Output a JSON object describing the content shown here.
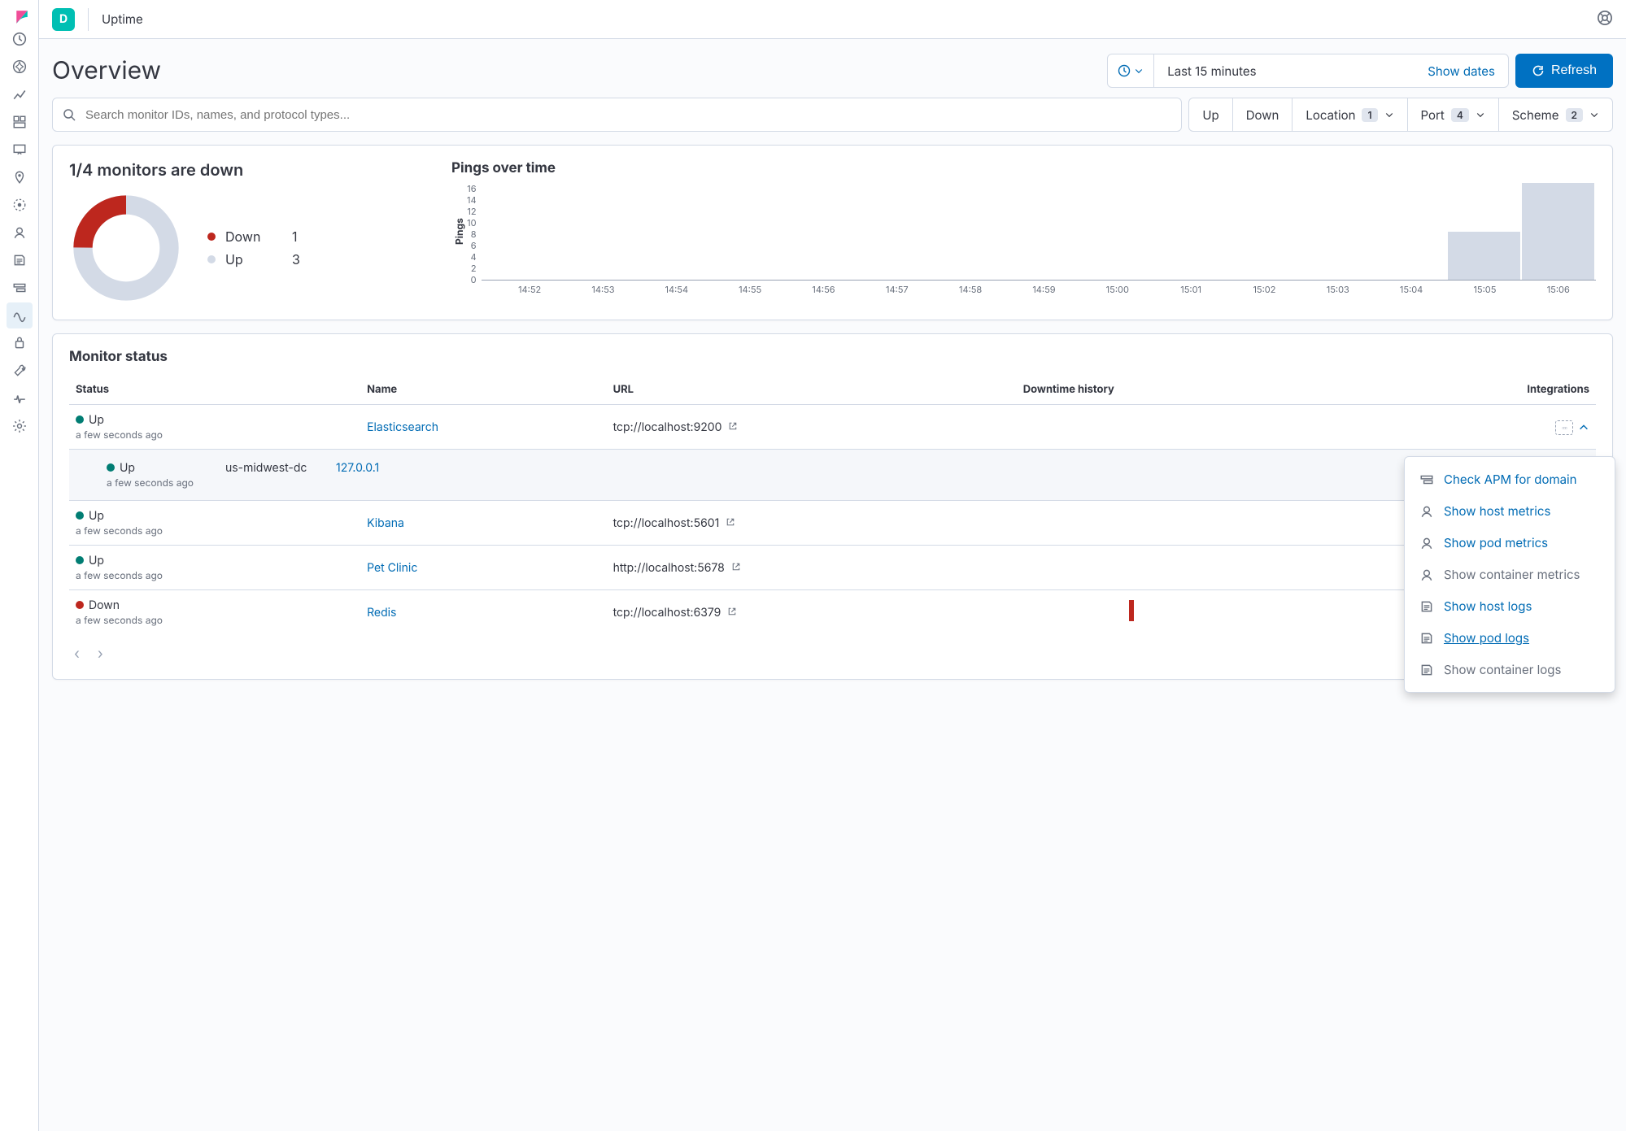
{
  "app": {
    "space_letter": "D",
    "breadcrumb": "Uptime"
  },
  "page": {
    "title": "Overview"
  },
  "datepicker": {
    "range": "Last 15 minutes",
    "show_dates": "Show dates",
    "refresh": "Refresh"
  },
  "search": {
    "placeholder": "Search monitor IDs, names, and protocol types..."
  },
  "filters": {
    "up": "Up",
    "down": "Down",
    "location": {
      "label": "Location",
      "count": "1"
    },
    "port": {
      "label": "Port",
      "count": "4"
    },
    "scheme": {
      "label": "Scheme",
      "count": "2"
    }
  },
  "summary": {
    "headline": "1/4 monitors are down",
    "legend": {
      "down_label": "Down",
      "down_val": "1",
      "up_label": "Up",
      "up_val": "3"
    }
  },
  "pings_title": "Pings over time",
  "chart_data": {
    "type": "bar",
    "title": "Pings over time",
    "xlabel": "",
    "ylabel": "Pings",
    "ylim": [
      0,
      16
    ],
    "yticks": [
      0,
      2,
      4,
      6,
      8,
      10,
      12,
      14,
      16
    ],
    "categories": [
      "14:52",
      "14:53",
      "14:54",
      "14:55",
      "14:56",
      "14:57",
      "14:58",
      "14:59",
      "15:00",
      "15:01",
      "15:02",
      "15:03",
      "15:04",
      "15:05",
      "15:06"
    ],
    "values": [
      0,
      0,
      0,
      0,
      0,
      0,
      0,
      0,
      0,
      0,
      0,
      0,
      0,
      8,
      16
    ]
  },
  "table": {
    "title": "Monitor status",
    "headers": {
      "status": "Status",
      "name": "Name",
      "url": "URL",
      "downtime": "Downtime history",
      "integrations": "Integrations"
    },
    "rows": [
      {
        "status": "Up",
        "ago": "a few seconds ago",
        "name": "Elasticsearch",
        "url": "tcp://localhost:9200",
        "down": false,
        "expanded": true
      },
      {
        "status": "Up",
        "ago": "a few seconds ago",
        "name": "Kibana",
        "url": "tcp://localhost:5601",
        "down": false
      },
      {
        "status": "Up",
        "ago": "a few seconds ago",
        "name": "Pet Clinic",
        "url": "http://localhost:5678",
        "down": false
      },
      {
        "status": "Down",
        "ago": "a few seconds ago",
        "name": "Redis",
        "url": "tcp://localhost:6379",
        "down": true
      }
    ],
    "expanded": {
      "status": "Up",
      "ago": "a few seconds ago",
      "location": "us-midwest-dc",
      "ip": "127.0.0.1"
    }
  },
  "popover": {
    "items": [
      {
        "label": "Check APM for domain",
        "enabled": true,
        "icon": "apm"
      },
      {
        "label": "Show host metrics",
        "enabled": true,
        "icon": "metrics"
      },
      {
        "label": "Show pod metrics",
        "enabled": true,
        "icon": "metrics"
      },
      {
        "label": "Show container metrics",
        "enabled": false,
        "icon": "metrics"
      },
      {
        "label": "Show host logs",
        "enabled": true,
        "icon": "logs"
      },
      {
        "label": "Show pod logs",
        "enabled": true,
        "icon": "logs",
        "underline": true
      },
      {
        "label": "Show container logs",
        "enabled": false,
        "icon": "logs"
      }
    ]
  }
}
